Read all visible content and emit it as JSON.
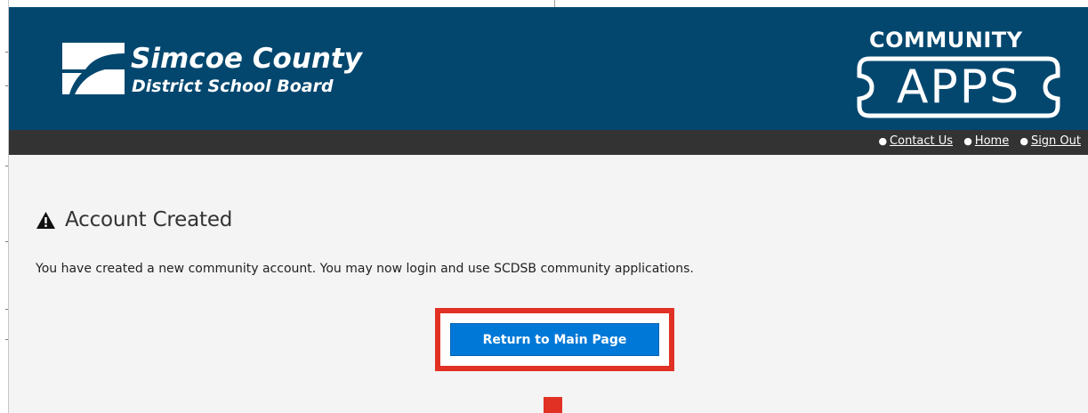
{
  "header": {
    "brand_line1": "Simcoe County",
    "brand_line2": "District School Board",
    "apps_label_top": "COMMUNITY",
    "apps_label_main": "APPS"
  },
  "nav": {
    "items": [
      {
        "label": "Contact Us"
      },
      {
        "label": "Home"
      },
      {
        "label": "Sign Out"
      }
    ]
  },
  "main": {
    "heading": "Account Created",
    "message": "You have created a new community account. You may now login and use SCDSB community applications.",
    "return_button_label": "Return to Main Page"
  },
  "icons": {
    "heading_icon": "warning-triangle-icon",
    "logo_icon": "scdsb-logo-icon"
  },
  "colors": {
    "header_bg": "#03476f",
    "navbar_bg": "#333333",
    "content_bg": "#f4f4f4",
    "button_bg": "#0078d7",
    "highlight": "#e03124"
  }
}
